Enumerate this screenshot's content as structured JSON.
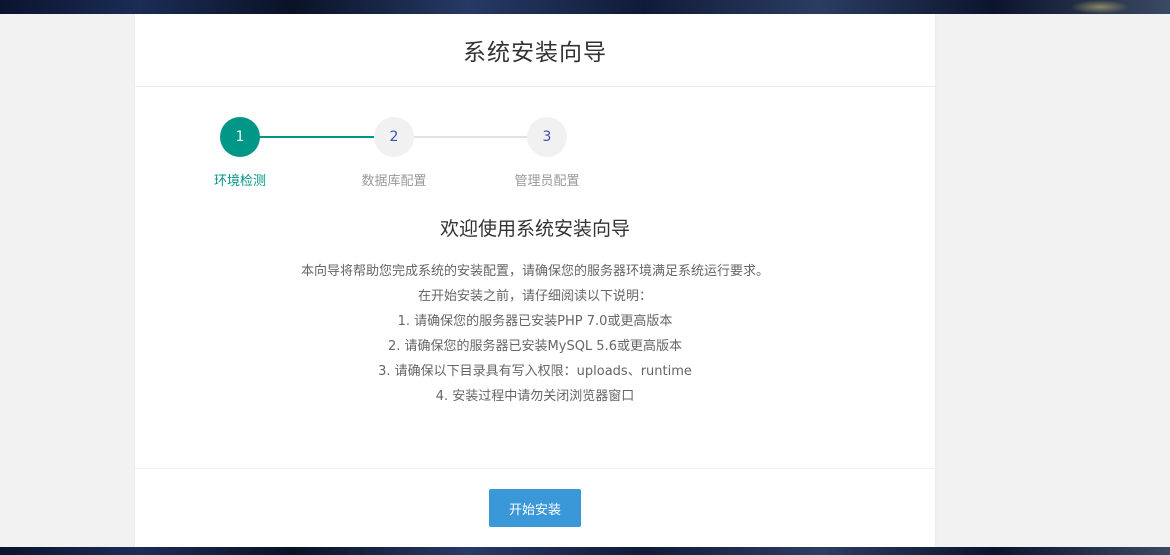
{
  "header": {
    "title": "系统安装向导"
  },
  "steps": [
    {
      "number": "1",
      "label": "环境检测",
      "state": "done"
    },
    {
      "number": "2",
      "label": "数据库配置",
      "state": "todo"
    },
    {
      "number": "3",
      "label": "管理员配置",
      "state": "todo"
    }
  ],
  "main": {
    "welcome_title": "欢迎使用系统安装向导",
    "intro": "本向导将帮助您完成系统的安装配置，请确保您的服务器环境满足系统运行要求。",
    "instructions_heading": "在开始安装之前，请仔细阅读以下说明：",
    "notes": [
      "1. 请确保您的服务器已安装PHP 7.0或更高版本",
      "2. 请确保您的服务器已安装MySQL 5.6或更高版本",
      "3. 请确保以下目录具有写入权限：uploads、runtime",
      "4. 安装过程中请勿关闭浏览器窗口"
    ]
  },
  "footer": {
    "start_label": "开始安装"
  },
  "colors": {
    "accent": "#009688",
    "button": "#3a97d8",
    "step_number_inactive": "#3f51b5"
  }
}
